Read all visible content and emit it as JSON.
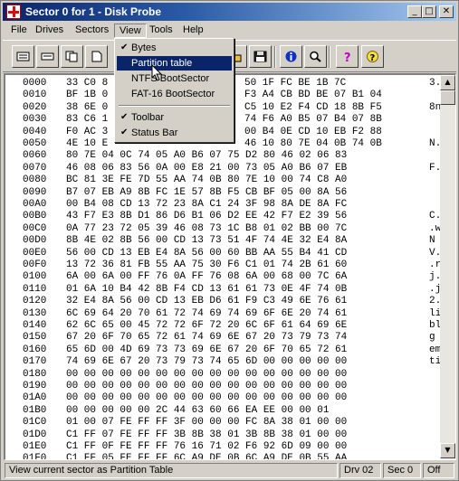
{
  "window": {
    "title": "Sector 0 for 1 - Disk Probe",
    "controls": [
      "_",
      "□",
      "✕"
    ]
  },
  "menubar": [
    "File",
    "Drives",
    "Sectors",
    "View",
    "Tools",
    "Help"
  ],
  "toolbar": {
    "buttons": [
      "view-bytes-icon",
      "view-partition-icon",
      "copy-icon",
      "page-icon",
      "open-icon",
      "save-icon",
      "info-icon",
      "zoom-icon",
      "help-icon",
      "context-help-icon"
    ]
  },
  "view_menu": {
    "items": [
      {
        "label": "Bytes",
        "checked": true,
        "highlighted": false
      },
      {
        "label": "Partition table",
        "checked": false,
        "highlighted": true
      },
      {
        "label": "NTFS BootSector",
        "checked": false,
        "highlighted": false
      },
      {
        "label": "FAT-16 BootSector",
        "checked": false,
        "highlighted": false
      },
      {
        "label": "Toolbar",
        "checked": true,
        "highlighted": false
      },
      {
        "label": "Status Bar",
        "checked": true,
        "highlighted": false
      }
    ]
  },
  "hex": {
    "rows": [
      {
        "offset": "0000",
        "left": "33 C0 8",
        "right": "50 1F FC BE 1B 7C",
        "ascii": "3."
      },
      {
        "offset": "0010",
        "left": "BF 1B 0",
        "right": "F3 A4 CB BD BE 07 B1 04",
        "ascii": ""
      },
      {
        "offset": "0020",
        "left": "38 6E 0",
        "right": "C5 10 E2 F4 CD 18 8B F5",
        "ascii": "8n"
      },
      {
        "offset": "0030",
        "left": "83 C6 1",
        "right": "74 F6 A0 B5 07 B4 07 8B",
        "ascii": ""
      },
      {
        "offset": "0040",
        "left": "F0 AC 3",
        "right": "00 B4 0E CD 10 EB F2 88",
        "ascii": ""
      },
      {
        "offset": "0050",
        "left": "4E 10 E",
        "right": "46 10 80 7E 04 0B 74 0B",
        "ascii": "N."
      },
      {
        "offset": "0060",
        "left": "80 7E 04 0C 74 05 A0 B6 07 75 D2 80 46 02 06 83",
        "right": "",
        "ascii": ""
      },
      {
        "offset": "0070",
        "left": "46 08 06 83 56 0A 00 E8 21 00 73 05 A0 B6 07 EB",
        "right": "",
        "ascii": "F."
      },
      {
        "offset": "0080",
        "left": "BC 81 3E FE 7D 55 AA 74 0B 80 7E 10 00 74 C8 A0",
        "right": "",
        "ascii": ""
      },
      {
        "offset": "0090",
        "left": "B7 07 EB A9 8B FC 1E 57 8B F5 CB BF 05 00 8A 56",
        "right": "",
        "ascii": ""
      },
      {
        "offset": "00A0",
        "left": "00 B4 08 CD 13 72 23 8A C1 24 3F 98 8A DE 8A FC",
        "right": "",
        "ascii": ""
      },
      {
        "offset": "00B0",
        "left": "43 F7 E3 8B D1 86 D6 B1 06 D2 EE 42 F7 E2 39 56",
        "right": "",
        "ascii": "C."
      },
      {
        "offset": "00C0",
        "left": "0A 77 23 72 05 39 46 08 73 1C B8 01 02 BB 00 7C",
        "right": "",
        "ascii": ".w"
      },
      {
        "offset": "00D0",
        "left": "8B 4E 02 8B 56 00 CD 13 73 51 4F 74 4E 32 E4 8A",
        "right": "",
        "ascii": "N"
      },
      {
        "offset": "00E0",
        "left": "56 00 CD 13 EB E4 8A 56 00 60 BB AA 55 B4 41 CD",
        "right": "",
        "ascii": "V."
      },
      {
        "offset": "00F0",
        "left": "13 72 36 81 FB 55 AA 75 30 F6 C1 01 74 2B 61 60",
        "right": "",
        "ascii": ".r"
      },
      {
        "offset": "0100",
        "left": "6A 00 6A 00 FF 76 0A FF 76 08 6A 00 68 00 7C 6A",
        "right": "",
        "ascii": "j."
      },
      {
        "offset": "0110",
        "left": "01 6A 10 B4 42 8B F4 CD 13 61 61 73 0E 4F 74 0B",
        "right": "",
        "ascii": ".j"
      },
      {
        "offset": "0120",
        "left": "32 E4 8A 56 00 CD 13 EB D6 61 F9 C3 49 6E 76 61",
        "right": "",
        "ascii": "2."
      },
      {
        "offset": "0130",
        "left": "6C 69 64 20 70 61 72 74 69 74 69 6F 6E 20 74 61",
        "right": "",
        "ascii": "li"
      },
      {
        "offset": "0140",
        "left": "62 6C 65 00 45 72 72 6F 72 20 6C 6F 61 64 69 6E",
        "right": "",
        "ascii": "bl"
      },
      {
        "offset": "0150",
        "left": "67 20 6F 70 65 72 61 74 69 6E 67 20 73 79 73 74",
        "right": "",
        "ascii": "g"
      },
      {
        "offset": "0160",
        "left": "65 6D 00 4D 69 73 73 69 6E 67 20 6F 70 65 72 61",
        "right": "",
        "ascii": "em"
      },
      {
        "offset": "0170",
        "left": "74 69 6E 67 20 73 79 73 74 65 6D 00 00 00 00 00",
        "right": "",
        "ascii": "ti"
      },
      {
        "offset": "0180",
        "left": "00 00 00 00 00 00 00 00 00 00 00 00 00 00 00 00",
        "right": "",
        "ascii": ""
      },
      {
        "offset": "0190",
        "left": "00 00 00 00 00 00 00 00 00 00 00 00 00 00 00 00",
        "right": "",
        "ascii": ""
      },
      {
        "offset": "01A0",
        "left": "00 00 00 00 00 00 00 00 00 00 00 00 00 00 00 00",
        "right": "",
        "ascii": ""
      },
      {
        "offset": "01B0",
        "left": "00 00 00 00 00 2C 44 63 60 66 EA EE 00 00 01",
        "right": "",
        "ascii": ""
      },
      {
        "offset": "01C0",
        "left": "01 00 07 FE FF FF 3F 00 00 00 FC 8A 38 01 00 00",
        "right": "",
        "ascii": ""
      },
      {
        "offset": "01D0",
        "left": "C1 FF 07 FE FF FF 3B 8B 38 01 3B 8B 38 01 00 00",
        "right": "",
        "ascii": ""
      },
      {
        "offset": "01E0",
        "left": "C1 FF 0F FE FF FF 76 16 71 02 F6 92 6D 09 00 00",
        "right": "",
        "ascii": ""
      },
      {
        "offset": "01F0",
        "left": "C1 FF 05 FE FF FF 6C A9 DE 0B 6C A9 DE 0B 55 AA",
        "right": "",
        "ascii": ""
      }
    ]
  },
  "statusbar": {
    "message": "View current sector as Partition Table",
    "drive": "Drv  02",
    "sector": "Sec  0",
    "mode": "Off"
  },
  "colors": {
    "title_start": "#0a246a",
    "title_end": "#a6caf0",
    "highlight": "#0a246a",
    "face": "#d4d0c8"
  }
}
